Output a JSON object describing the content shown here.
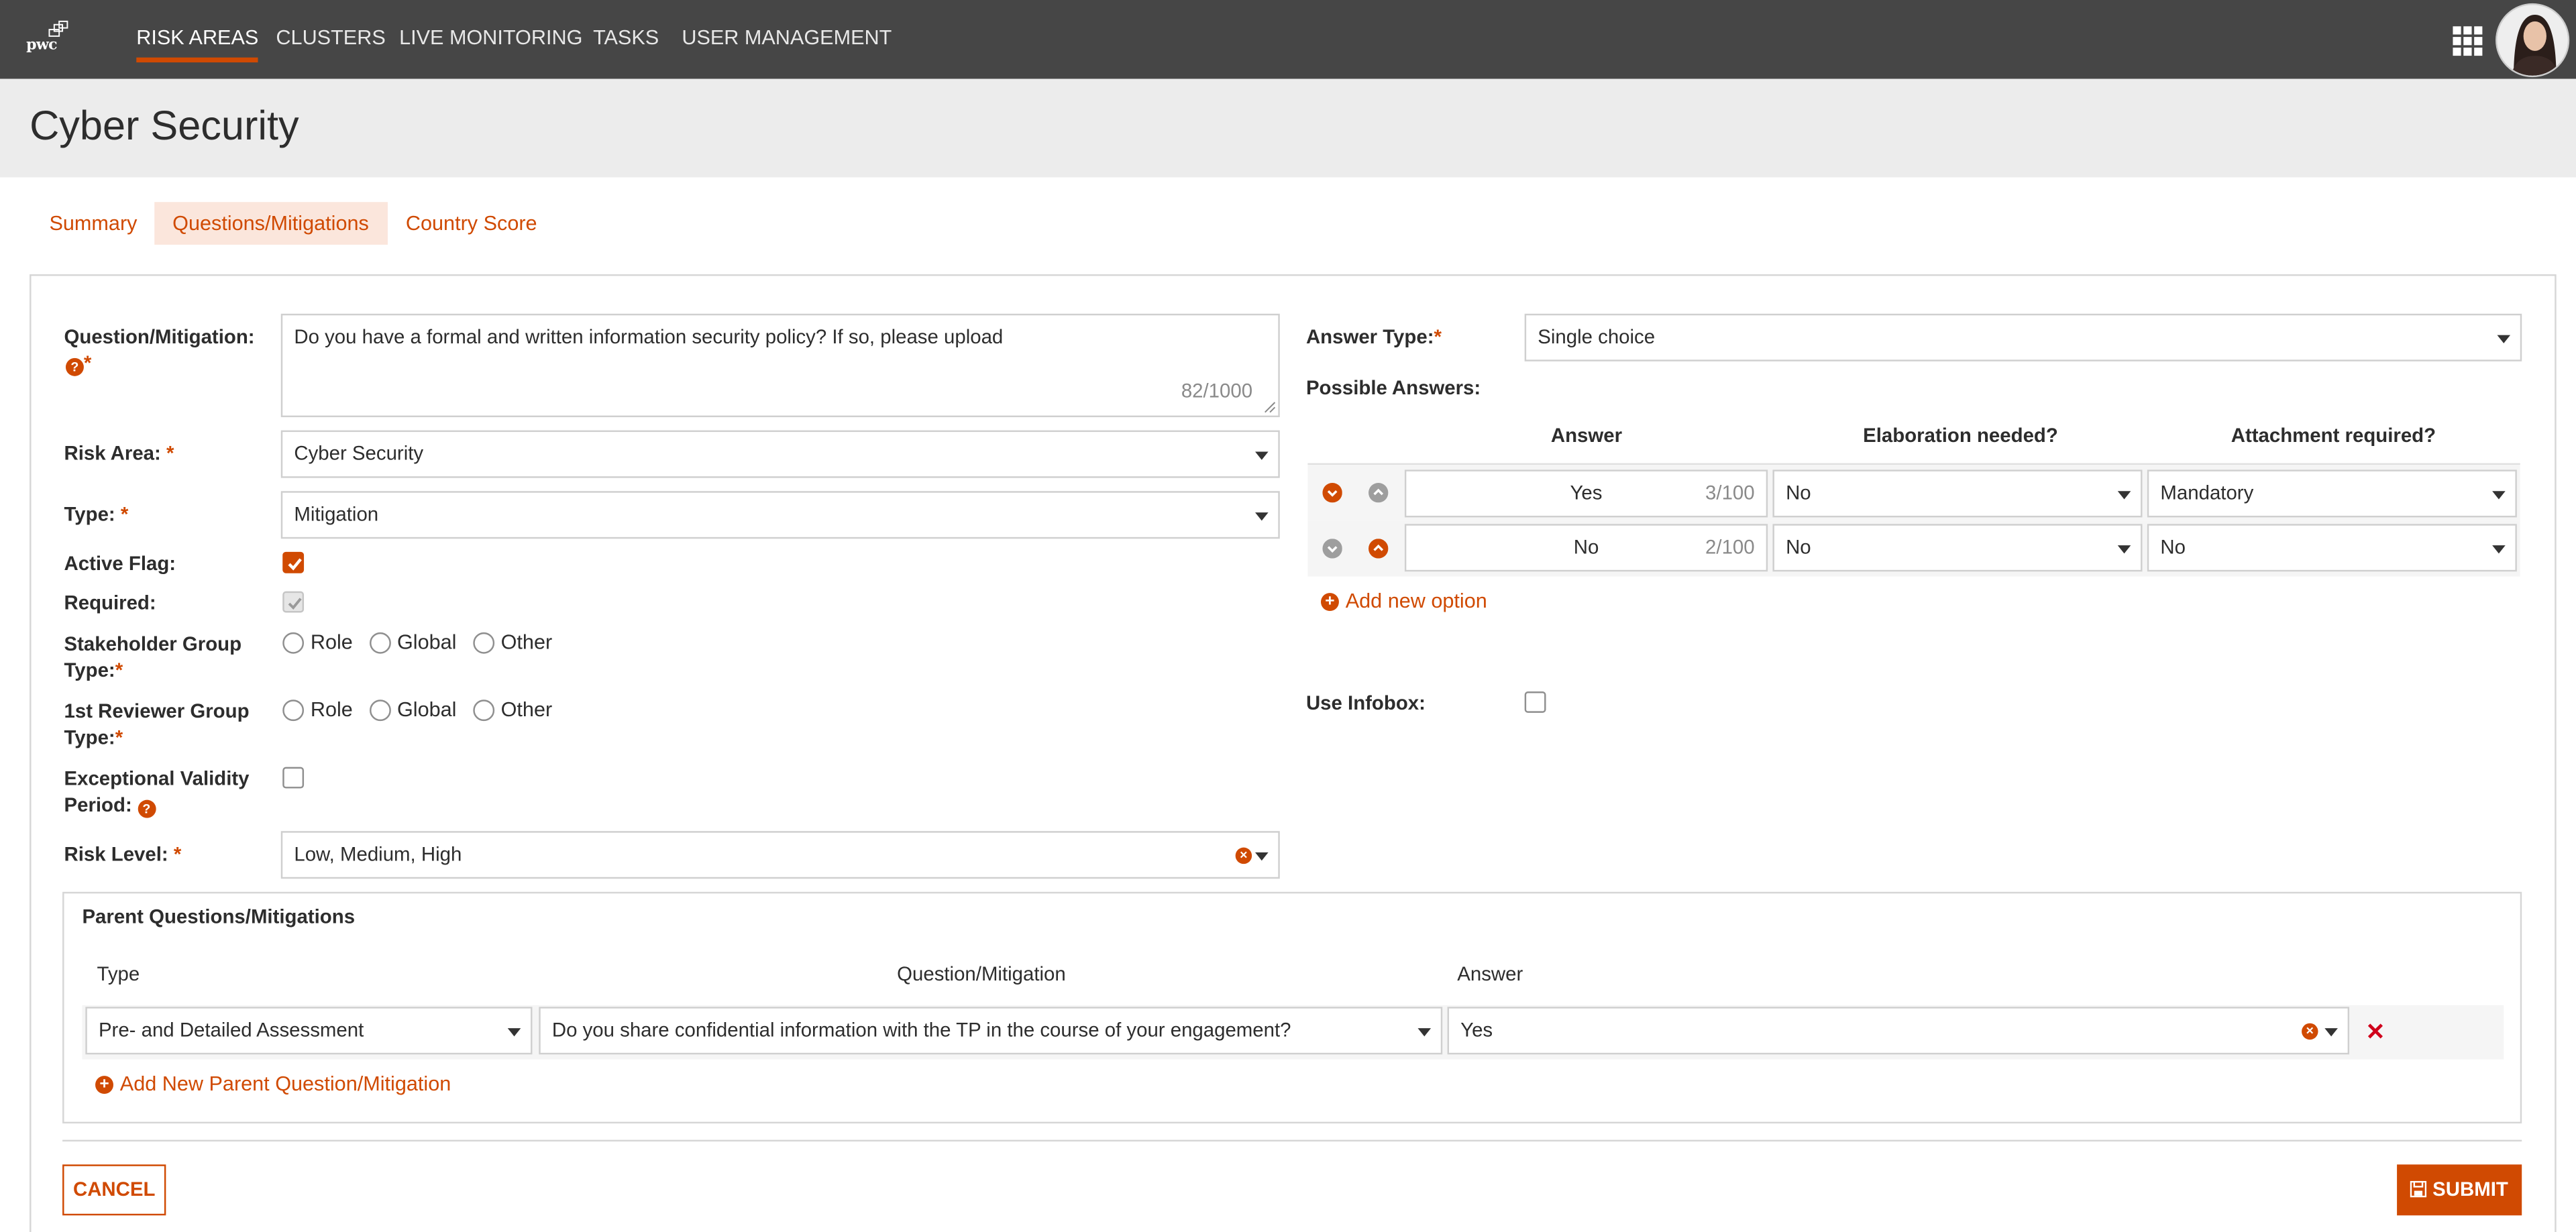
{
  "nav": {
    "logo_text": "pwc",
    "items": [
      "RISK AREAS",
      "CLUSTERS",
      "LIVE MONITORING",
      "TASKS",
      "USER MANAGEMENT"
    ]
  },
  "page": {
    "title": "Cyber Security"
  },
  "tabs": [
    "Summary",
    "Questions/Mitigations",
    "Country Score"
  ],
  "form": {
    "question": {
      "label": "Question/Mitigation:",
      "value": "Do you have a formal and written information security policy? If so, please upload",
      "counter": "82/1000"
    },
    "risk_area": {
      "label": "Risk Area:",
      "value": "Cyber Security"
    },
    "type": {
      "label": "Type:",
      "value": "Mitigation"
    },
    "active_flag": {
      "label": "Active Flag:"
    },
    "required": {
      "label": "Required:"
    },
    "stakeholder": {
      "label_line1": "Stakeholder Group",
      "label_line2": "Type:",
      "options": [
        "Role",
        "Global",
        "Other"
      ]
    },
    "reviewer": {
      "label_line1": "1st Reviewer Group",
      "label_line2": "Type:",
      "options": [
        "Role",
        "Global",
        "Other"
      ]
    },
    "exceptional": {
      "label_line1": "Exceptional Validity",
      "label_line2": "Period:"
    },
    "risk_level": {
      "label": "Risk Level:",
      "value": "Low, Medium, High"
    },
    "answer_type": {
      "label": "Answer Type:",
      "value": "Single choice"
    },
    "possible_answers": {
      "label": "Possible Answers:",
      "headers": [
        "Answer",
        "Elaboration needed?",
        "Attachment required?"
      ],
      "rows": [
        {
          "answer": "Yes",
          "counter": "3/100",
          "elaboration": "No",
          "attachment": "Mandatory"
        },
        {
          "answer": "No",
          "counter": "2/100",
          "elaboration": "No",
          "attachment": "No"
        }
      ],
      "add_label": "Add new option"
    },
    "infobox": {
      "label": "Use Infobox:"
    }
  },
  "parents": {
    "title": "Parent Questions/Mitigations",
    "headers": [
      "Type",
      "Question/Mitigation",
      "Answer"
    ],
    "row": {
      "type": "Pre- and Detailed Assessment",
      "question": "Do you share confidential information with the TP in the course of your engagement?",
      "answer": "Yes"
    },
    "add_label": "Add New Parent Question/Mitigation"
  },
  "actions": {
    "cancel": "CANCEL",
    "submit": "SUBMIT"
  },
  "colors": {
    "accent": "#d04a02",
    "nav_bg": "#464646",
    "title_bg": "#ececec",
    "tab_active_bg": "#fbe6dc"
  }
}
